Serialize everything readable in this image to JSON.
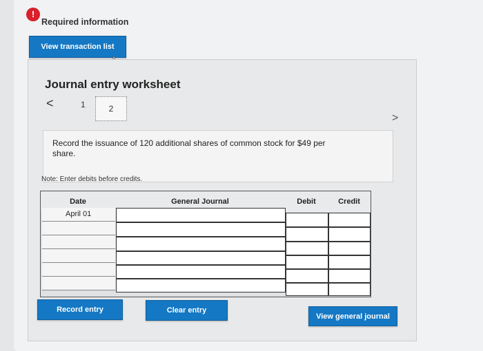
{
  "header": {
    "info_icon": "!",
    "title": "Required information",
    "view_transaction_list": "View transaction list"
  },
  "worksheet": {
    "title": "Journal entry worksheet",
    "prev_icon": "<",
    "next_icon": ">",
    "pages": [
      "1",
      "2"
    ],
    "active_page": "2",
    "prompt": "Record the issuance of 120 additional shares of common stock for $49 per share.",
    "note": "Note: Enter debits before credits."
  },
  "journal": {
    "columns": [
      "Date",
      "General Journal",
      "Debit",
      "Credit"
    ],
    "rows": [
      {
        "date": "April 01",
        "account": "",
        "debit": "",
        "credit": ""
      },
      {
        "date": "",
        "account": "",
        "debit": "",
        "credit": ""
      },
      {
        "date": "",
        "account": "",
        "debit": "",
        "credit": ""
      },
      {
        "date": "",
        "account": "",
        "debit": "",
        "credit": ""
      },
      {
        "date": "",
        "account": "",
        "debit": "",
        "credit": ""
      },
      {
        "date": "",
        "account": "",
        "debit": "",
        "credit": ""
      }
    ]
  },
  "buttons": {
    "record_entry": "Record entry",
    "clear_entry": "Clear entry",
    "view_general_journal": "View general journal"
  },
  "colors": {
    "accent_blue": "#1478c4",
    "info_red": "#d9202c"
  }
}
